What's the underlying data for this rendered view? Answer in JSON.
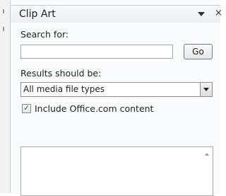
{
  "pane": {
    "title": "Clip Art",
    "menu_icon": "dropdown-arrow-icon",
    "close_label": "×"
  },
  "search": {
    "label": "Search for:",
    "value": "",
    "placeholder": "",
    "go_label": "Go"
  },
  "results_filter": {
    "label": "Results should be:",
    "selected": "All media file types"
  },
  "include_office": {
    "checked": true,
    "check_glyph": "✓",
    "label": "Include Office.com content"
  },
  "results_list": {
    "items": []
  }
}
